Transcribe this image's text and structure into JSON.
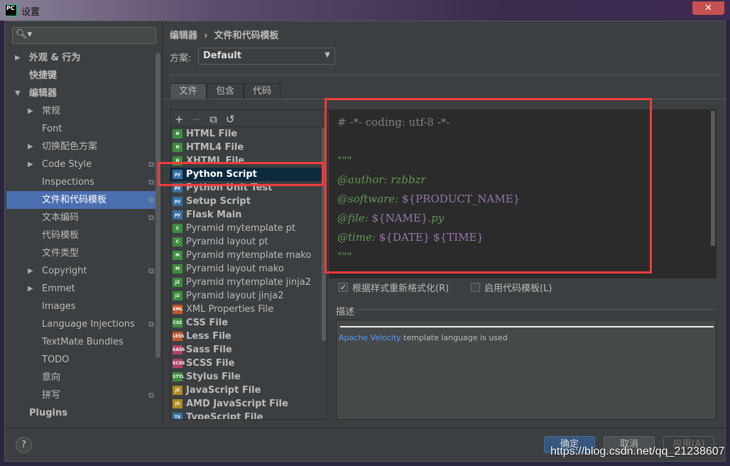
{
  "window": {
    "title": "设置",
    "logo": "PC",
    "close": "✕"
  },
  "sidebar": {
    "search_placeholder": "",
    "items": [
      {
        "label": "外观 & 行为",
        "level": 0,
        "arrow": "▶",
        "bold": true
      },
      {
        "label": "快捷键",
        "level": 0,
        "bold": true
      },
      {
        "label": "编辑器",
        "level": 0,
        "arrow": "▼",
        "bold": true
      },
      {
        "label": "常规",
        "level": 1,
        "arrow": "▶"
      },
      {
        "label": "Font",
        "level": 1
      },
      {
        "label": "切换配色方案",
        "level": 1,
        "arrow": "▶"
      },
      {
        "label": "Code Style",
        "level": 1,
        "arrow": "▶",
        "copy": true
      },
      {
        "label": "Inspections",
        "level": 1,
        "copy": true
      },
      {
        "label": "文件和代码模板",
        "level": 1,
        "copy": true,
        "selected": true
      },
      {
        "label": "文本编码",
        "level": 1,
        "copy": true
      },
      {
        "label": "代码模板",
        "level": 1
      },
      {
        "label": "文件类型",
        "level": 1
      },
      {
        "label": "Copyright",
        "level": 1,
        "arrow": "▶",
        "copy": true
      },
      {
        "label": "Emmet",
        "level": 1,
        "arrow": "▶"
      },
      {
        "label": "Images",
        "level": 1
      },
      {
        "label": "Language Injections",
        "level": 1,
        "copy": true
      },
      {
        "label": "TextMate Bundles",
        "level": 1
      },
      {
        "label": "TODO",
        "level": 1
      },
      {
        "label": "意向",
        "level": 1
      },
      {
        "label": "拼写",
        "level": 1,
        "copy": true
      },
      {
        "label": "Plugins",
        "level": 0,
        "bold": true
      }
    ]
  },
  "breadcrumb": {
    "parent": "编辑器",
    "sep": "›",
    "current": "文件和代码模板"
  },
  "scheme": {
    "label": "方案:",
    "value": "Default"
  },
  "tabs": [
    {
      "label": "文件",
      "active": true
    },
    {
      "label": "包含"
    },
    {
      "label": "代码"
    }
  ],
  "toolbar": {
    "add": "+",
    "remove": "−",
    "copy": "⧉",
    "reset": "↺"
  },
  "files": [
    {
      "label": "HTML File",
      "bold": true,
      "icon": "H",
      "color": "#3d8f3d"
    },
    {
      "label": "HTML4 File",
      "bold": true,
      "icon": "H",
      "color": "#3d8f3d"
    },
    {
      "label": "XHTML File",
      "bold": true,
      "icon": "H",
      "color": "#3d8f3d"
    },
    {
      "label": "Python Script",
      "bold": true,
      "icon": "py",
      "color": "#3572a5",
      "selected": true
    },
    {
      "label": "Python Unit Test",
      "bold": true,
      "icon": "py",
      "color": "#3572a5"
    },
    {
      "label": "Setup Script",
      "bold": true,
      "icon": "py",
      "color": "#3572a5"
    },
    {
      "label": "Flask Main",
      "bold": true,
      "icon": "py",
      "color": "#3572a5"
    },
    {
      "label": "Pyramid mytemplate pt",
      "icon": "C",
      "color": "#3d8f3d"
    },
    {
      "label": "Pyramid layout pt",
      "icon": "C",
      "color": "#3d8f3d"
    },
    {
      "label": "Pyramid mytemplate mako",
      "icon": "M",
      "color": "#3d8f3d"
    },
    {
      "label": "Pyramid layout mako",
      "icon": "M",
      "color": "#3d8f3d"
    },
    {
      "label": "Pyramid mytemplate jinja2",
      "icon": "J2",
      "color": "#3d8f3d"
    },
    {
      "label": "Pyramid layout jinja2",
      "icon": "J2",
      "color": "#3d8f3d"
    },
    {
      "label": "XML Properties File",
      "icon": "XML",
      "color": "#c05a2a"
    },
    {
      "label": "CSS File",
      "bold": true,
      "icon": "CSS",
      "color": "#3d8f3d"
    },
    {
      "label": "Less File",
      "bold": true,
      "icon": "LESS",
      "color": "#c05a2a"
    },
    {
      "label": "Sass File",
      "bold": true,
      "icon": "SASS",
      "color": "#b0406a"
    },
    {
      "label": "SCSS File",
      "bold": true,
      "icon": "SCSS",
      "color": "#b0406a"
    },
    {
      "label": "Stylus File",
      "bold": true,
      "icon": "STYL",
      "color": "#3d8f3d"
    },
    {
      "label": "JavaScript File",
      "bold": true,
      "icon": "JS",
      "color": "#b08a20"
    },
    {
      "label": "AMD JavaScript File",
      "bold": true,
      "icon": "JS",
      "color": "#b08a20"
    },
    {
      "label": "TypeScript File",
      "bold": true,
      "icon": "TS",
      "color": "#3572a5"
    }
  ],
  "editor": {
    "lines": [
      [
        {
          "t": "# -*- coding: utf-8 -*-",
          "c": "cm"
        }
      ],
      [],
      [
        {
          "t": "\"\"\"",
          "c": "doc"
        }
      ],
      [
        {
          "t": "@author: rzbbzr",
          "c": "doc"
        }
      ],
      [
        {
          "t": "@software: ",
          "c": "doc"
        },
        {
          "t": "${PRODUCT_NAME}",
          "c": "var"
        }
      ],
      [
        {
          "t": "@file: ",
          "c": "doc"
        },
        {
          "t": "${NAME}",
          "c": "var"
        },
        {
          "t": ".py",
          "c": "doc"
        }
      ],
      [
        {
          "t": "@time: ",
          "c": "doc"
        },
        {
          "t": "${DATE}",
          "c": "var"
        },
        {
          "t": " ",
          "c": "doc"
        },
        {
          "t": "${TIME}",
          "c": "var"
        }
      ],
      [
        {
          "t": "\"\"\"",
          "c": "doc"
        }
      ]
    ]
  },
  "options": {
    "reformat": {
      "label": "根据样式重新格式化(R)",
      "checked": true
    },
    "live_template": {
      "label": "启用代码模板(L)",
      "checked": false
    }
  },
  "description": {
    "label": "描述",
    "link": "Apache Velocity",
    "text": " template language is used"
  },
  "buttons": {
    "help": "?",
    "ok": "确定",
    "cancel": "取消",
    "apply": "应用(A)"
  },
  "watermark": "https://blog.csdn.net/qq_21238607",
  "colors": {
    "accent": "#4b6eaf",
    "highlight": "#f03c3c"
  }
}
